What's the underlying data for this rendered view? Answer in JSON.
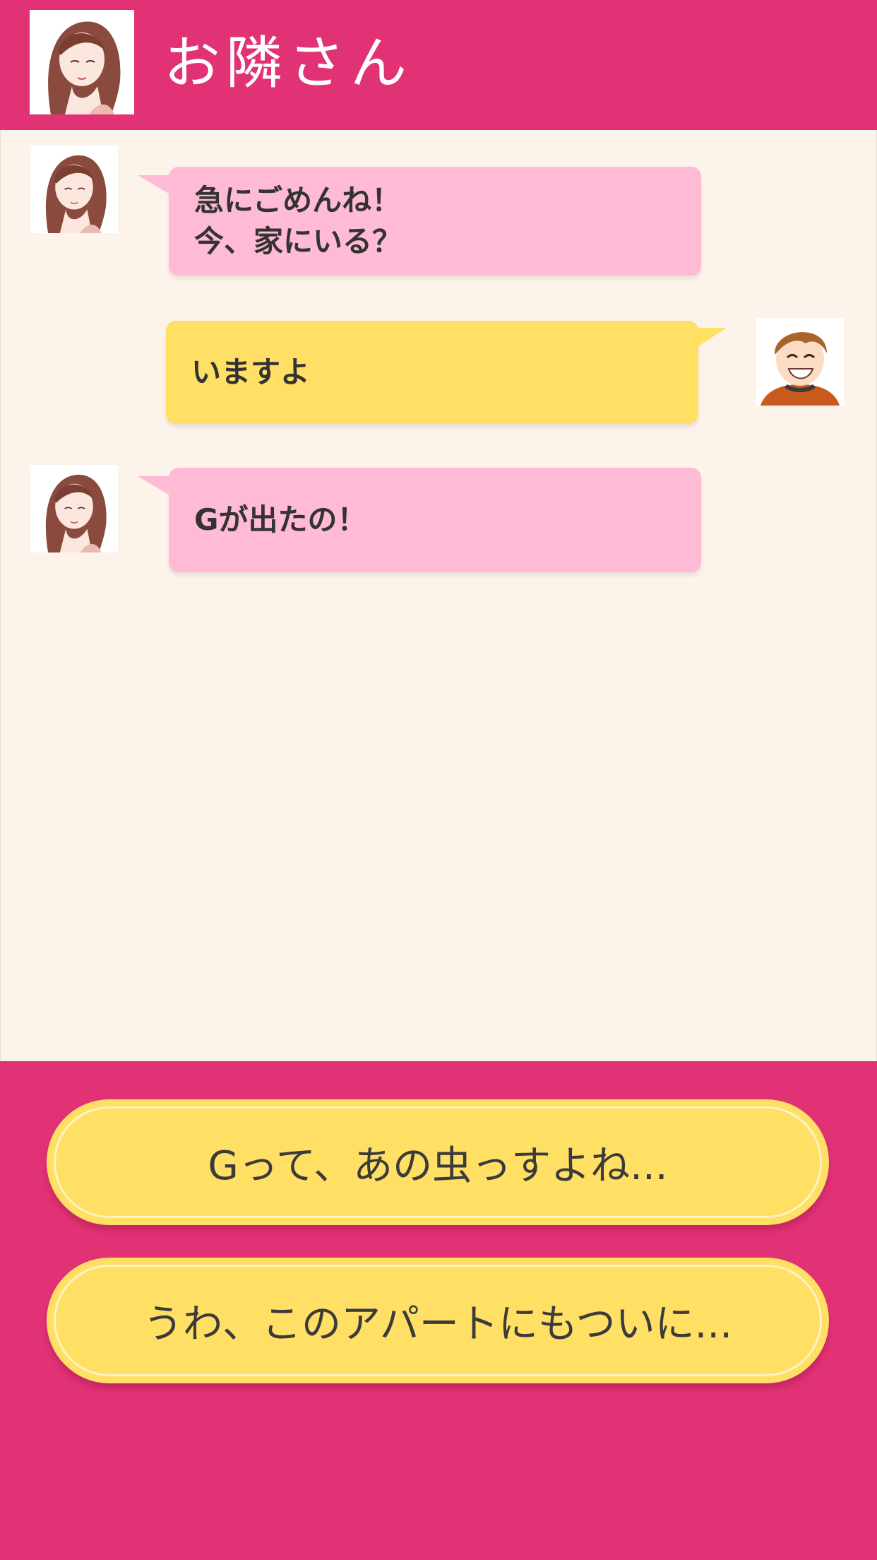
{
  "header": {
    "title": "お隣さん",
    "avatar_icon": "neighbor-woman-avatar"
  },
  "messages": [
    {
      "sender": "neighbor",
      "avatar_icon": "neighbor-woman-avatar",
      "lines": [
        "急にごめんね！",
        "今、家にいる？"
      ]
    },
    {
      "sender": "self",
      "avatar_icon": "smiling-boy-avatar",
      "lines": [
        "いますよ"
      ]
    },
    {
      "sender": "neighbor",
      "avatar_icon": "neighbor-woman-avatar",
      "lines": [
        "Gが出たの！"
      ]
    }
  ],
  "choices": [
    {
      "label": "Gって、あの虫っすよね..."
    },
    {
      "label": "うわ、このアパートにもついに..."
    }
  ],
  "colors": {
    "accent": "#e13275",
    "chat_background": "#fcf3ea",
    "incoming_bubble": "#ffbad5",
    "outgoing_bubble": "#ffdf64",
    "choice_button": "#ffdf64"
  }
}
